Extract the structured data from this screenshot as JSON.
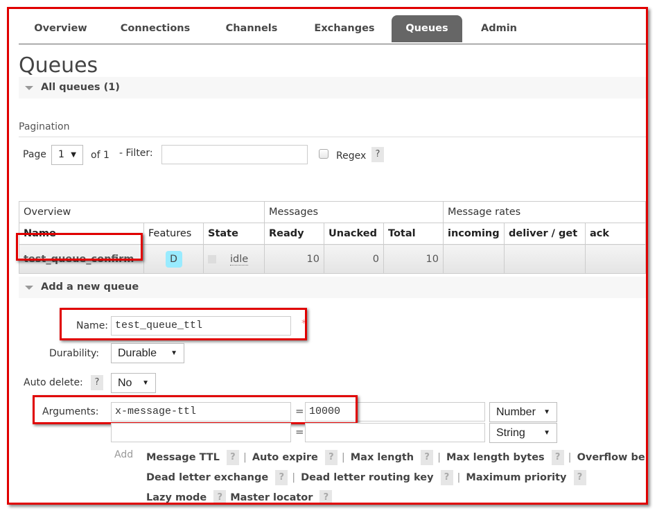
{
  "nav": {
    "tabs": [
      {
        "label": "Overview",
        "active": false
      },
      {
        "label": "Connections",
        "active": false
      },
      {
        "label": "Channels",
        "active": false
      },
      {
        "label": "Exchanges",
        "active": false
      },
      {
        "label": "Queues",
        "active": true
      },
      {
        "label": "Admin",
        "active": false
      }
    ]
  },
  "page_title": "Queues",
  "all_queues": {
    "header": "All queues (1)",
    "pagination_label": "Pagination",
    "page_label": "Page",
    "page_value": "1",
    "of_label": "of 1",
    "filter_label": "- Filter:",
    "filter_value": "",
    "regex_label": "Regex",
    "regex_checked": false,
    "help": "?"
  },
  "table": {
    "groups": [
      "Overview",
      "Messages",
      "Message rates"
    ],
    "columns": [
      "Name",
      "Features",
      "State",
      "Ready",
      "Unacked",
      "Total",
      "incoming",
      "deliver / get",
      "ack"
    ],
    "rows": [
      {
        "name": "test_queue_confirm",
        "feature": "D",
        "state": "idle",
        "ready": "10",
        "unacked": "0",
        "total": "10",
        "incoming": "",
        "deliver_get": "",
        "ack": ""
      }
    ]
  },
  "add_queue": {
    "header": "Add a new queue",
    "name_label": "Name:",
    "name_value": "test_queue_ttl",
    "required_mark": "*",
    "durability_label": "Durability:",
    "durability_value": "Durable",
    "auto_delete_label": "Auto delete:",
    "auto_delete_value": "No",
    "arguments_label": "Arguments:",
    "arguments": [
      {
        "key": "x-message-ttl",
        "value": "10000",
        "type": "Number"
      },
      {
        "key": "",
        "value": "",
        "type": "String"
      }
    ],
    "equals": "=",
    "add_label": "Add",
    "arg_links_row1": [
      "Message TTL",
      "Auto expire",
      "Max length",
      "Max length bytes",
      "Overflow behaviour"
    ],
    "arg_links_row2": [
      "Dead letter exchange",
      "Dead letter routing key",
      "Maximum priority"
    ],
    "arg_links_row3": [
      "Lazy mode",
      "Master locator"
    ],
    "separator": "|",
    "help": "?"
  }
}
